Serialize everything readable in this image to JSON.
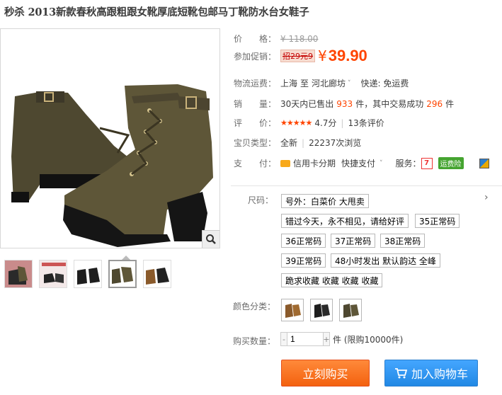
{
  "product": {
    "title": "秒杀 2013新款春秋高跟粗跟女靴厚底短靴包邮马丁靴防水台女鞋子"
  },
  "price": {
    "label": "价　　格：",
    "original": "¥ 118.00"
  },
  "promo": {
    "label": "参加促销：",
    "tag": "招29元9",
    "yen": "¥",
    "price": "39.90"
  },
  "shipping": {
    "label": "物流运费：",
    "from": "上海",
    "sep": "至",
    "to": "河北廊坊",
    "dropdown": "˅",
    "fee": "快递: 免运费"
  },
  "sales": {
    "label": "销　　量：",
    "prefix": "30天内已售出",
    "sold": "933",
    "middle": "件，其中交易成功",
    "success": "296",
    "suffix": "件"
  },
  "rating": {
    "label": "评　　价：",
    "stars": "★★★★★",
    "score": "4.7分",
    "sep": "|",
    "reviews": "13条评价"
  },
  "item_type": {
    "label": "宝贝类型：",
    "value": "全新",
    "sep": "|",
    "views": "22237次浏览"
  },
  "payment": {
    "label": "支　　付：",
    "credit": "信用卡分期",
    "quick": "快捷支付",
    "dropdown": "˅",
    "service_label": "服务：",
    "yunfei": "运费险",
    "right_arrow": "›",
    "seven": "7"
  },
  "sku": {
    "size_label": "尺码：",
    "right_arrow": "›",
    "options": [
      "号外：白菜价 大甩卖",
      "错过今天，永不相见，请给好评",
      "35正常码",
      "36正常码",
      "37正常码",
      "38正常码",
      "39正常码",
      "48小时发出 默认韵达 全峰",
      "跪求收藏 收藏 收藏 收藏"
    ],
    "color_label": "颜色分类："
  },
  "quantity": {
    "label": "购买数量：",
    "minus": "-",
    "value": "1",
    "plus": "+",
    "stock": "件 (限购10000件)"
  },
  "buttons": {
    "buy": "立刻购买",
    "cart": "加入购物车"
  },
  "colors": {
    "accent": "#ff4400",
    "buy_btn": "#f3610f",
    "cart_btn": "#2188e4",
    "boot_olive": "#5e5638",
    "boot_brown": "#8a5a2b",
    "boot_black": "#1e1e1e"
  },
  "icons": {
    "zoom": "magnifier-icon",
    "cart": "cart-icon",
    "card": "credit-card-icon"
  }
}
